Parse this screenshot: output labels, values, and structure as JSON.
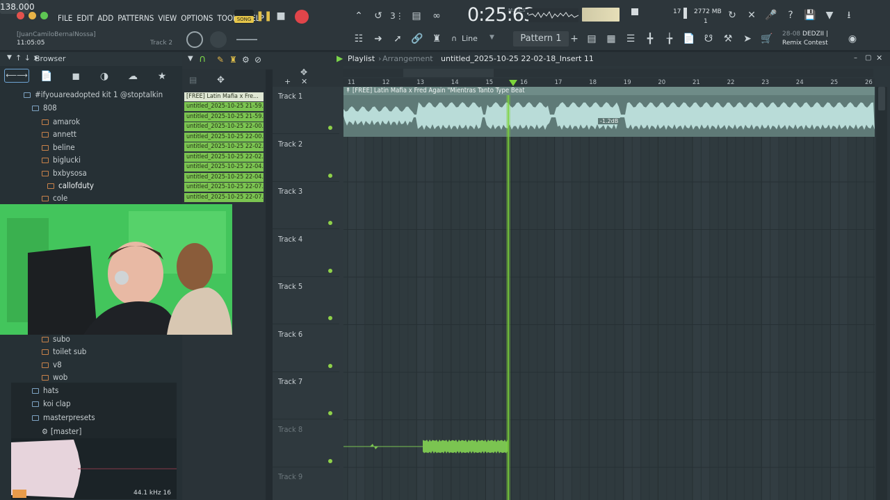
{
  "menu": [
    "FILE",
    "EDIT",
    "ADD",
    "PATTERNS",
    "VIEW",
    "OPTIONS",
    "TOOLS",
    "HELP"
  ],
  "transport": {
    "mode": "SONG",
    "tempo": "138.000",
    "time": "0:25:63",
    "time_label": "M:S:CS"
  },
  "hint": {
    "user": "[JuanCamiloBernalNossa]",
    "clock": "11:05:05",
    "track": "Track 2"
  },
  "perf": {
    "cpu": "17",
    "mem": "2772 MB",
    "voices": "1"
  },
  "snap": "Line",
  "pattern": "Pattern 1",
  "news": {
    "date": "28-08",
    "line1": "DEDZII |",
    "line2": "Remix Contest"
  },
  "browser": {
    "title": "Browser",
    "items": [
      {
        "label": "#ifyouareadopted kit 1 @stoptalkin",
        "kind": "folder-open",
        "indent": 0
      },
      {
        "label": "808",
        "kind": "folder-open",
        "indent": 1
      },
      {
        "label": "amarok",
        "kind": "folder",
        "indent": 2
      },
      {
        "label": "annett",
        "kind": "folder",
        "indent": 2
      },
      {
        "label": "beline",
        "kind": "folder",
        "indent": 2
      },
      {
        "label": "biglucki",
        "kind": "folder",
        "indent": 2
      },
      {
        "label": "bxbysosa",
        "kind": "folder",
        "indent": 2
      },
      {
        "label": "callofduty",
        "kind": "folder",
        "indent": 3
      },
      {
        "label": "cole",
        "kind": "folder",
        "indent": 2
      }
    ],
    "items_lower": [
      {
        "label": "subo",
        "kind": "folder"
      },
      {
        "label": "toilet sub",
        "kind": "folder"
      },
      {
        "label": "v8",
        "kind": "folder"
      },
      {
        "label": "wob",
        "kind": "folder"
      },
      {
        "label": "hats",
        "kind": "folder-blue"
      },
      {
        "label": "koi clap",
        "kind": "folder-blue"
      },
      {
        "label": "masterpresets",
        "kind": "folder-blue"
      },
      {
        "label": "[master]",
        "kind": "preset"
      }
    ],
    "sample_info": "44.1 kHz 16"
  },
  "picker": [
    "[FREE] Latin Mafia x Fre...",
    "untitled_2025-10-25 21-59...",
    "untitled_2025-10-25 21-59...",
    "untitled_2025-10-25 22-00...",
    "untitled_2025-10-25 22-00...",
    "untitled_2025-10-25 22-02...",
    "untitled_2025-10-25 22-02...",
    "untitled_2025-10-25 22-04...",
    "untitled_2025-10-25 22-04...",
    "untitled_2025-10-25 22-07...",
    "untitled_2025-10-25 22-07..."
  ],
  "playlist": {
    "title": "Playlist",
    "subtitle": "Arrangement",
    "file": "untitled_2025-10-25 22-02-18_Insert 11",
    "clip_title": "[FREE] Latin Mafia x Fred Again \"Mientras Tanto Type Beat",
    "clip_gain": "-1.2dB",
    "tracks": [
      "Track 1",
      "Track 2",
      "Track 3",
      "Track 4",
      "Track 5",
      "Track 6",
      "Track 7",
      "Track 8",
      "Track 9"
    ],
    "bars": [
      "11",
      "12",
      "13",
      "14",
      "15",
      "16",
      "17",
      "18",
      "19",
      "20",
      "21",
      "22",
      "23",
      "24",
      "25",
      "26"
    ]
  },
  "colors": {
    "clip_green": "#7bc451",
    "wave": "#b9dcd8",
    "playhead": "#7cd43a",
    "record": "#e0454a"
  }
}
